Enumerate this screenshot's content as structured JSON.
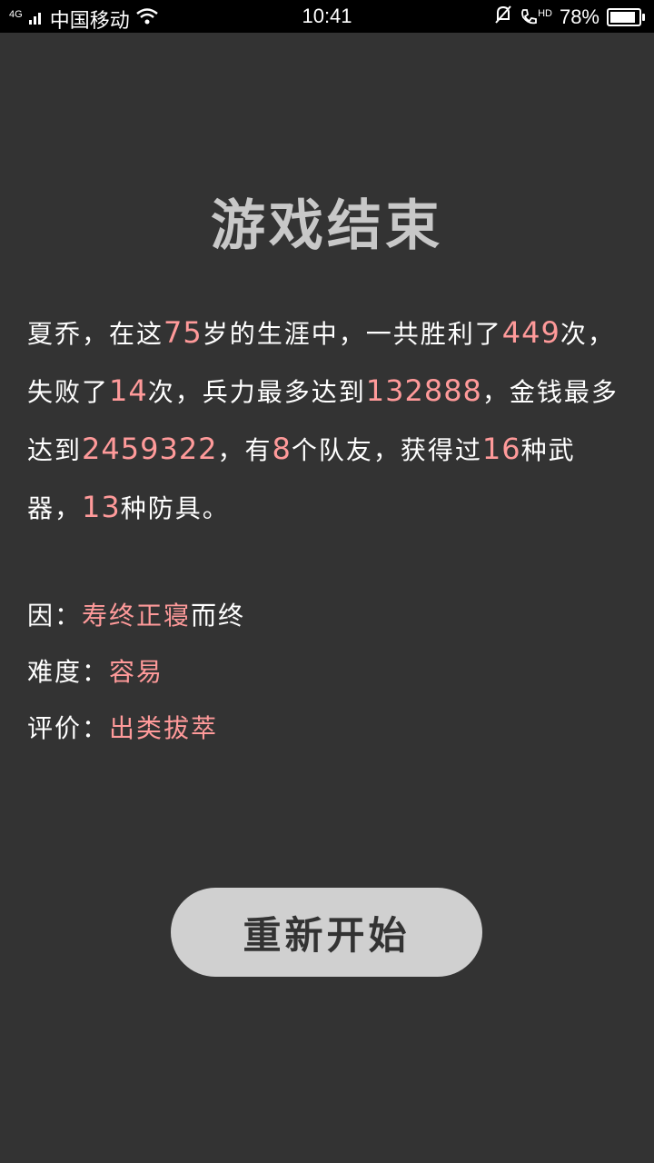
{
  "status_bar": {
    "network": "4G",
    "carrier": "中国移动",
    "time": "10:41",
    "hd": "HD",
    "battery": "78%",
    "battery_level": 0.78
  },
  "title": "游戏结束",
  "summary": {
    "name": "夏乔",
    "t1": "，在这",
    "age": "75",
    "t2": "岁的生涯中，一共胜利了",
    "wins": "449",
    "t3": "次，失败了",
    "losses": "14",
    "t4": "次，兵力最多达到",
    "max_troops": "132888",
    "t5": "，金钱最多达到",
    "max_money": "2459322",
    "t6": "，有",
    "teammates": "8",
    "t7": "个队友，获得过",
    "weapons": "16",
    "t8": "种武器，",
    "armors": "13",
    "t9": "种防具。"
  },
  "cause": {
    "label": "因：",
    "value": "寿终正寝",
    "suffix": "而终"
  },
  "difficulty": {
    "label": "难度：",
    "value": "容易"
  },
  "rating": {
    "label": "评价：",
    "value": "出类拔萃"
  },
  "restart_button": "重新开始",
  "colors": {
    "background": "#333333",
    "highlight": "#ff9a9a",
    "title": "#c8c8c8",
    "button_bg": "#d0d0d0"
  }
}
